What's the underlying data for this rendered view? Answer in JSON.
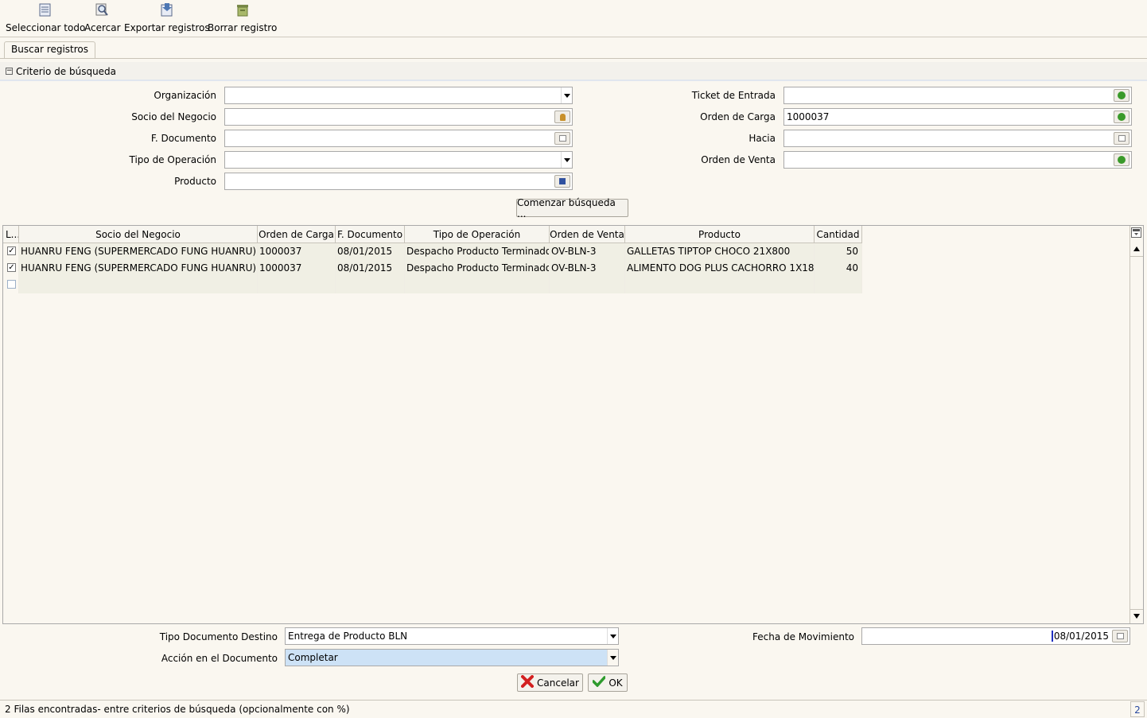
{
  "toolbar": {
    "select_all": "Seleccionar todo",
    "zoom": "Acercar",
    "export": "Exportar registros",
    "delete": "Borrar registro"
  },
  "tab": "Buscar registros",
  "criteria": {
    "title": "Criterio de búsqueda",
    "left": {
      "organizacion": {
        "label": "Organización",
        "value": ""
      },
      "socio": {
        "label": "Socio del Negocio",
        "value": ""
      },
      "fdoc": {
        "label": "F. Documento",
        "value": ""
      },
      "tipo_op": {
        "label": "Tipo de Operación",
        "value": ""
      },
      "producto": {
        "label": "Producto",
        "value": ""
      }
    },
    "right": {
      "ticket": {
        "label": "Ticket de Entrada",
        "value": ""
      },
      "orden_carga": {
        "label": "Orden de Carga",
        "value": "1000037"
      },
      "hacia": {
        "label": "Hacia",
        "value": ""
      },
      "orden_venta": {
        "label": "Orden de Venta",
        "value": ""
      }
    },
    "search_button": "Comenzar búsqueda ..."
  },
  "grid": {
    "headers": [
      "L...",
      "Socio del Negocio",
      "Orden de Carga",
      "F. Documento",
      "Tipo de Operación",
      "Orden de Venta",
      "Producto",
      "Cantidad"
    ],
    "rows": [
      {
        "checked": true,
        "socio": "HUANRU FENG (SUPERMERCADO FUNG HUANRU)",
        "orden_carga": "1000037",
        "fdoc": "08/01/2015",
        "tipo_op": "Despacho Producto Terminado",
        "orden_venta": "OV-BLN-3",
        "producto": "GALLETAS TIPTOP CHOCO 21X800",
        "cantidad": "50"
      },
      {
        "checked": true,
        "socio": "HUANRU FENG (SUPERMERCADO FUNG HUANRU)",
        "orden_carga": "1000037",
        "fdoc": "08/01/2015",
        "tipo_op": "Despacho Producto Terminado",
        "orden_venta": "OV-BLN-3",
        "producto": "ALIMENTO DOG PLUS CACHORRO 1X18",
        "cantidad": "40"
      },
      {
        "checked": false,
        "socio": "",
        "orden_carga": "",
        "fdoc": "",
        "tipo_op": "",
        "orden_venta": "",
        "producto": "",
        "cantidad": ""
      }
    ]
  },
  "bottom": {
    "tipo_doc": {
      "label": "Tipo Documento Destino",
      "value": "Entrega de Producto BLN"
    },
    "accion": {
      "label": "Acción en el Documento",
      "value": "Completar"
    },
    "fecha": {
      "label": "Fecha de Movimiento",
      "value": "08/01/2015"
    },
    "cancel": "Cancelar",
    "ok": "OK"
  },
  "status": {
    "text": "2 Filas encontradas- entre criterios de búsqueda (opcionalmente con %)",
    "count": "2"
  },
  "colors": {
    "accent_blue": "#cde2f6",
    "ok_green": "#2e9b2e",
    "cancel_red": "#d32020"
  }
}
